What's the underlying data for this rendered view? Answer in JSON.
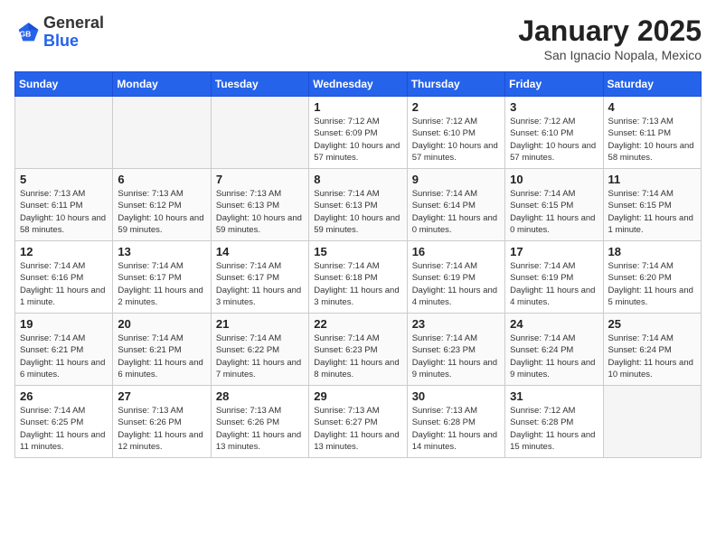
{
  "header": {
    "logo_general": "General",
    "logo_blue": "Blue",
    "title": "January 2025",
    "subtitle": "San Ignacio Nopala, Mexico"
  },
  "weekdays": [
    "Sunday",
    "Monday",
    "Tuesday",
    "Wednesday",
    "Thursday",
    "Friday",
    "Saturday"
  ],
  "weeks": [
    [
      {
        "day": "",
        "empty": true
      },
      {
        "day": "",
        "empty": true
      },
      {
        "day": "",
        "empty": true
      },
      {
        "day": "1",
        "sunrise": "7:12 AM",
        "sunset": "6:09 PM",
        "daylight": "10 hours and 57 minutes."
      },
      {
        "day": "2",
        "sunrise": "7:12 AM",
        "sunset": "6:10 PM",
        "daylight": "10 hours and 57 minutes."
      },
      {
        "day": "3",
        "sunrise": "7:12 AM",
        "sunset": "6:10 PM",
        "daylight": "10 hours and 57 minutes."
      },
      {
        "day": "4",
        "sunrise": "7:13 AM",
        "sunset": "6:11 PM",
        "daylight": "10 hours and 58 minutes."
      }
    ],
    [
      {
        "day": "5",
        "sunrise": "7:13 AM",
        "sunset": "6:11 PM",
        "daylight": "10 hours and 58 minutes."
      },
      {
        "day": "6",
        "sunrise": "7:13 AM",
        "sunset": "6:12 PM",
        "daylight": "10 hours and 59 minutes."
      },
      {
        "day": "7",
        "sunrise": "7:13 AM",
        "sunset": "6:13 PM",
        "daylight": "10 hours and 59 minutes."
      },
      {
        "day": "8",
        "sunrise": "7:14 AM",
        "sunset": "6:13 PM",
        "daylight": "10 hours and 59 minutes."
      },
      {
        "day": "9",
        "sunrise": "7:14 AM",
        "sunset": "6:14 PM",
        "daylight": "11 hours and 0 minutes."
      },
      {
        "day": "10",
        "sunrise": "7:14 AM",
        "sunset": "6:15 PM",
        "daylight": "11 hours and 0 minutes."
      },
      {
        "day": "11",
        "sunrise": "7:14 AM",
        "sunset": "6:15 PM",
        "daylight": "11 hours and 1 minute."
      }
    ],
    [
      {
        "day": "12",
        "sunrise": "7:14 AM",
        "sunset": "6:16 PM",
        "daylight": "11 hours and 1 minute."
      },
      {
        "day": "13",
        "sunrise": "7:14 AM",
        "sunset": "6:17 PM",
        "daylight": "11 hours and 2 minutes."
      },
      {
        "day": "14",
        "sunrise": "7:14 AM",
        "sunset": "6:17 PM",
        "daylight": "11 hours and 3 minutes."
      },
      {
        "day": "15",
        "sunrise": "7:14 AM",
        "sunset": "6:18 PM",
        "daylight": "11 hours and 3 minutes."
      },
      {
        "day": "16",
        "sunrise": "7:14 AM",
        "sunset": "6:19 PM",
        "daylight": "11 hours and 4 minutes."
      },
      {
        "day": "17",
        "sunrise": "7:14 AM",
        "sunset": "6:19 PM",
        "daylight": "11 hours and 4 minutes."
      },
      {
        "day": "18",
        "sunrise": "7:14 AM",
        "sunset": "6:20 PM",
        "daylight": "11 hours and 5 minutes."
      }
    ],
    [
      {
        "day": "19",
        "sunrise": "7:14 AM",
        "sunset": "6:21 PM",
        "daylight": "11 hours and 6 minutes."
      },
      {
        "day": "20",
        "sunrise": "7:14 AM",
        "sunset": "6:21 PM",
        "daylight": "11 hours and 6 minutes."
      },
      {
        "day": "21",
        "sunrise": "7:14 AM",
        "sunset": "6:22 PM",
        "daylight": "11 hours and 7 minutes."
      },
      {
        "day": "22",
        "sunrise": "7:14 AM",
        "sunset": "6:23 PM",
        "daylight": "11 hours and 8 minutes."
      },
      {
        "day": "23",
        "sunrise": "7:14 AM",
        "sunset": "6:23 PM",
        "daylight": "11 hours and 9 minutes."
      },
      {
        "day": "24",
        "sunrise": "7:14 AM",
        "sunset": "6:24 PM",
        "daylight": "11 hours and 9 minutes."
      },
      {
        "day": "25",
        "sunrise": "7:14 AM",
        "sunset": "6:24 PM",
        "daylight": "11 hours and 10 minutes."
      }
    ],
    [
      {
        "day": "26",
        "sunrise": "7:14 AM",
        "sunset": "6:25 PM",
        "daylight": "11 hours and 11 minutes."
      },
      {
        "day": "27",
        "sunrise": "7:13 AM",
        "sunset": "6:26 PM",
        "daylight": "11 hours and 12 minutes."
      },
      {
        "day": "28",
        "sunrise": "7:13 AM",
        "sunset": "6:26 PM",
        "daylight": "11 hours and 13 minutes."
      },
      {
        "day": "29",
        "sunrise": "7:13 AM",
        "sunset": "6:27 PM",
        "daylight": "11 hours and 13 minutes."
      },
      {
        "day": "30",
        "sunrise": "7:13 AM",
        "sunset": "6:28 PM",
        "daylight": "11 hours and 14 minutes."
      },
      {
        "day": "31",
        "sunrise": "7:12 AM",
        "sunset": "6:28 PM",
        "daylight": "11 hours and 15 minutes."
      },
      {
        "day": "",
        "empty": true
      }
    ]
  ]
}
